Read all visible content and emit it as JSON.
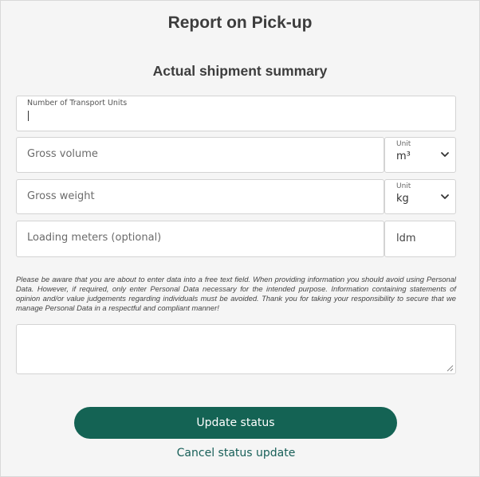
{
  "header": {
    "title": "Report on Pick-up",
    "subtitle": "Actual shipment summary"
  },
  "form": {
    "transport_units": {
      "label": "Number of Transport Units",
      "value": ""
    },
    "gross_volume": {
      "placeholder": "Gross volume",
      "unit_label": "Unit",
      "unit_value": "m³"
    },
    "gross_weight": {
      "placeholder": "Gross weight",
      "unit_label": "Unit",
      "unit_value": "kg"
    },
    "loading_meters": {
      "placeholder": "Loading meters (optional)",
      "unit_value": "ldm"
    },
    "notice": "Please be aware that you are about to enter data into a free text field. When providing information you should avoid using Personal Data. However, if required, only enter Personal Data necessary for the intended purpose. Information containing statements of opinion and/or value judgements regarding individuals must be avoided. Thank you for taking your responsibility to secure that we manage Personal Data in a respectful and compliant manner!",
    "comment_value": ""
  },
  "actions": {
    "update_label": "Update status",
    "cancel_label": "Cancel status update"
  },
  "colors": {
    "accent": "#146354",
    "link": "#175f58",
    "background": "#f5f5f5"
  },
  "icons": {
    "dropdown": "chevron-down-icon",
    "resize": "resize-grip-icon"
  }
}
